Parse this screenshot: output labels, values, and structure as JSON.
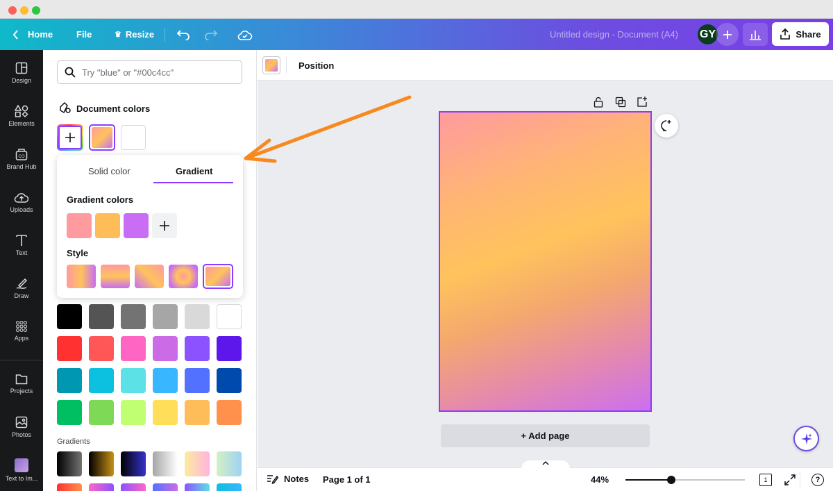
{
  "window": {
    "controls": [
      "#ff5f57",
      "#febc2e",
      "#28c840"
    ]
  },
  "topbar": {
    "home_label": "Home",
    "file_label": "File",
    "resize_label": "Resize",
    "doc_title": "Untitled design - Document (A4)",
    "avatar_initials": "GY",
    "share_label": "Share"
  },
  "rail": {
    "items": [
      {
        "label": "Design",
        "icon": "design-icon"
      },
      {
        "label": "Elements",
        "icon": "elements-icon"
      },
      {
        "label": "Brand Hub",
        "icon": "brand-hub-icon"
      },
      {
        "label": "Uploads",
        "icon": "uploads-icon"
      },
      {
        "label": "Text",
        "icon": "text-icon"
      },
      {
        "label": "Draw",
        "icon": "draw-icon"
      },
      {
        "label": "Apps",
        "icon": "apps-icon"
      },
      {
        "label": "Projects",
        "icon": "projects-icon"
      },
      {
        "label": "Photos",
        "icon": "photos-icon"
      },
      {
        "label": "Text to Im...",
        "icon": "text-to-image-icon"
      }
    ]
  },
  "panel": {
    "search_placeholder": "Try \"blue\" or \"#00c4cc\"",
    "document_colors_title": "Document colors",
    "gradients_title": "Gradients",
    "popover": {
      "tab_solid": "Solid color",
      "tab_gradient": "Gradient",
      "gradient_colors_title": "Gradient colors",
      "style_title": "Style",
      "gradient_colors": [
        "#ff9a9e",
        "#ffbd5a",
        "#c86df4"
      ]
    },
    "default_colors": [
      [
        "#000000",
        "#545454",
        "#737373",
        "#a6a6a6",
        "#d9d9d9",
        "#ffffff"
      ],
      [
        "#ff3131",
        "#ff5757",
        "#ff66c4",
        "#cb6ce6",
        "#8c52ff",
        "#5e17eb"
      ],
      [
        "#0097b2",
        "#0cc0df",
        "#5ce1e6",
        "#38b6ff",
        "#5271ff",
        "#004aad"
      ],
      [
        "#00bf63",
        "#7ed957",
        "#c1ff72",
        "#ffde59",
        "#ffbd59",
        "#ff914d"
      ]
    ]
  },
  "context": {
    "position_label": "Position"
  },
  "canvas": {
    "add_page_label": "+ Add page"
  },
  "bottom": {
    "notes_label": "Notes",
    "page_label": "Page 1 of 1",
    "zoom_label": "44%",
    "page_count": "1",
    "zoom_fraction": 0.44
  }
}
